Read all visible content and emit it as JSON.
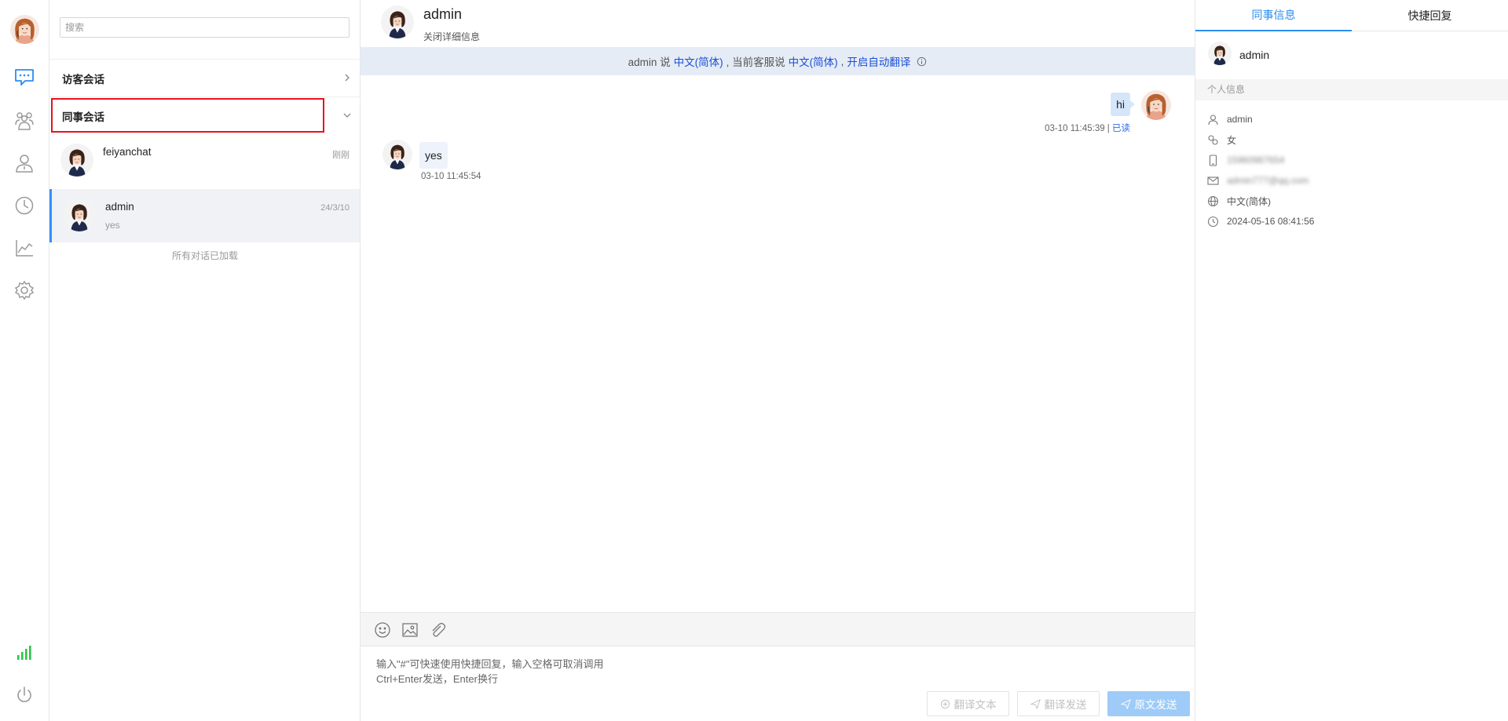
{
  "sidebar": {
    "nav_icons": [
      "chat-icon",
      "colleagues-icon",
      "user-icon",
      "history-icon",
      "stats-icon",
      "settings-icon"
    ],
    "bottom_icons": [
      "signal-icon",
      "power-icon"
    ]
  },
  "session_list": {
    "search_placeholder": "搜索",
    "group_visitor": "访客会话",
    "group_colleague": "同事会话",
    "sessions": [
      {
        "name": "feiyanchat",
        "time": "刚刚",
        "preview": ""
      },
      {
        "name": "admin",
        "time": "24/3/10",
        "preview": "yes"
      }
    ],
    "all_loaded": "所有对话已加载"
  },
  "chat": {
    "title": "admin",
    "close_detail": "关闭详细信息",
    "lang_bar": {
      "prefix": "admin 说",
      "lang1": "中文(简体)",
      "middle": ", 当前客服说",
      "lang2": "中文(简体)",
      "comma": ",",
      "auto_translate": "开启自动翻译"
    },
    "messages": [
      {
        "from": "me",
        "text": "hi",
        "time": "03-10 11:45:39 |",
        "status": "已读"
      },
      {
        "from": "other",
        "text": "yes",
        "time": "03-10 11:45:54"
      }
    ],
    "toolbar_icons": [
      "emoji-icon",
      "image-icon",
      "attachment-icon"
    ],
    "hint_line1": "输入\"#\"可快速使用快捷回复，输入空格可取消调用",
    "hint_line2": "Ctrl+Enter发送，Enter换行",
    "btn_translate_text": "翻译文本",
    "btn_translate_send": "翻译发送",
    "btn_original_send": "原文发送"
  },
  "side_panel": {
    "tab_colleague_info": "同事信息",
    "tab_quick_reply": "快捷回复",
    "name": "admin",
    "section_title": "个人信息",
    "fields": {
      "username": "admin",
      "gender": "女",
      "phone": "15960987654",
      "email": "admin777@qq.com",
      "language": "中文(简体)",
      "created": "2024-05-16 08:41:56"
    }
  },
  "colors": {
    "accent": "#2a8ef0",
    "highlight_box": "#e8121c",
    "lang_bar_bg": "#e6ecf6",
    "my_bubble": "#d5e6fb",
    "signal": "#2ec44a"
  }
}
